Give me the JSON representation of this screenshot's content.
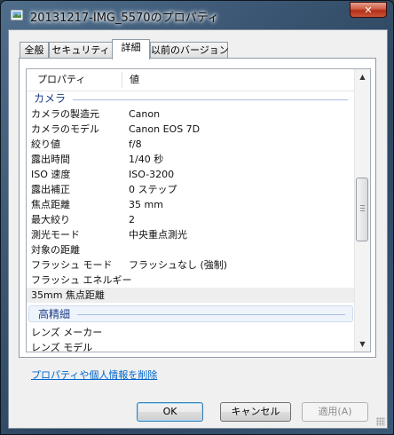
{
  "window": {
    "title": "20131217-IMG_5570のプロパティ",
    "close_label": "✕"
  },
  "tabs": [
    {
      "label": "全般"
    },
    {
      "label": "セキュリティ"
    },
    {
      "label": "詳細",
      "active": true
    },
    {
      "label": "以前のバージョン"
    }
  ],
  "list": {
    "header": {
      "name": "プロパティ",
      "value": "値"
    },
    "groups": [
      {
        "title": "カメラ",
        "rows": [
          {
            "name": "カメラの製造元",
            "value": "Canon"
          },
          {
            "name": "カメラのモデル",
            "value": "Canon EOS 7D"
          },
          {
            "name": "絞り値",
            "value": "f/8"
          },
          {
            "name": "露出時間",
            "value": "1/40 秒"
          },
          {
            "name": "ISO 速度",
            "value": "ISO-3200"
          },
          {
            "name": "露出補正",
            "value": "0 ステップ"
          },
          {
            "name": "焦点距離",
            "value": "35 mm"
          },
          {
            "name": "最大絞り",
            "value": "2"
          },
          {
            "name": "測光モード",
            "value": "中央重点測光"
          },
          {
            "name": "対象の距離",
            "value": ""
          },
          {
            "name": "フラッシュ モード",
            "value": "フラッシュなし (強制)"
          },
          {
            "name": "フラッシュ エネルギー",
            "value": ""
          },
          {
            "name": "35mm 焦点距離",
            "value": ""
          }
        ]
      },
      {
        "title": "高精細",
        "rows": [
          {
            "name": "レンズ メーカー",
            "value": ""
          },
          {
            "name": "レンズ モデル",
            "value": ""
          }
        ]
      }
    ],
    "scroll_up": "▲",
    "scroll_down": "▼"
  },
  "remove_link": "プロパティや個人情報を削除",
  "buttons": {
    "ok": "OK",
    "cancel": "キャンセル",
    "apply": "適用(A)"
  }
}
